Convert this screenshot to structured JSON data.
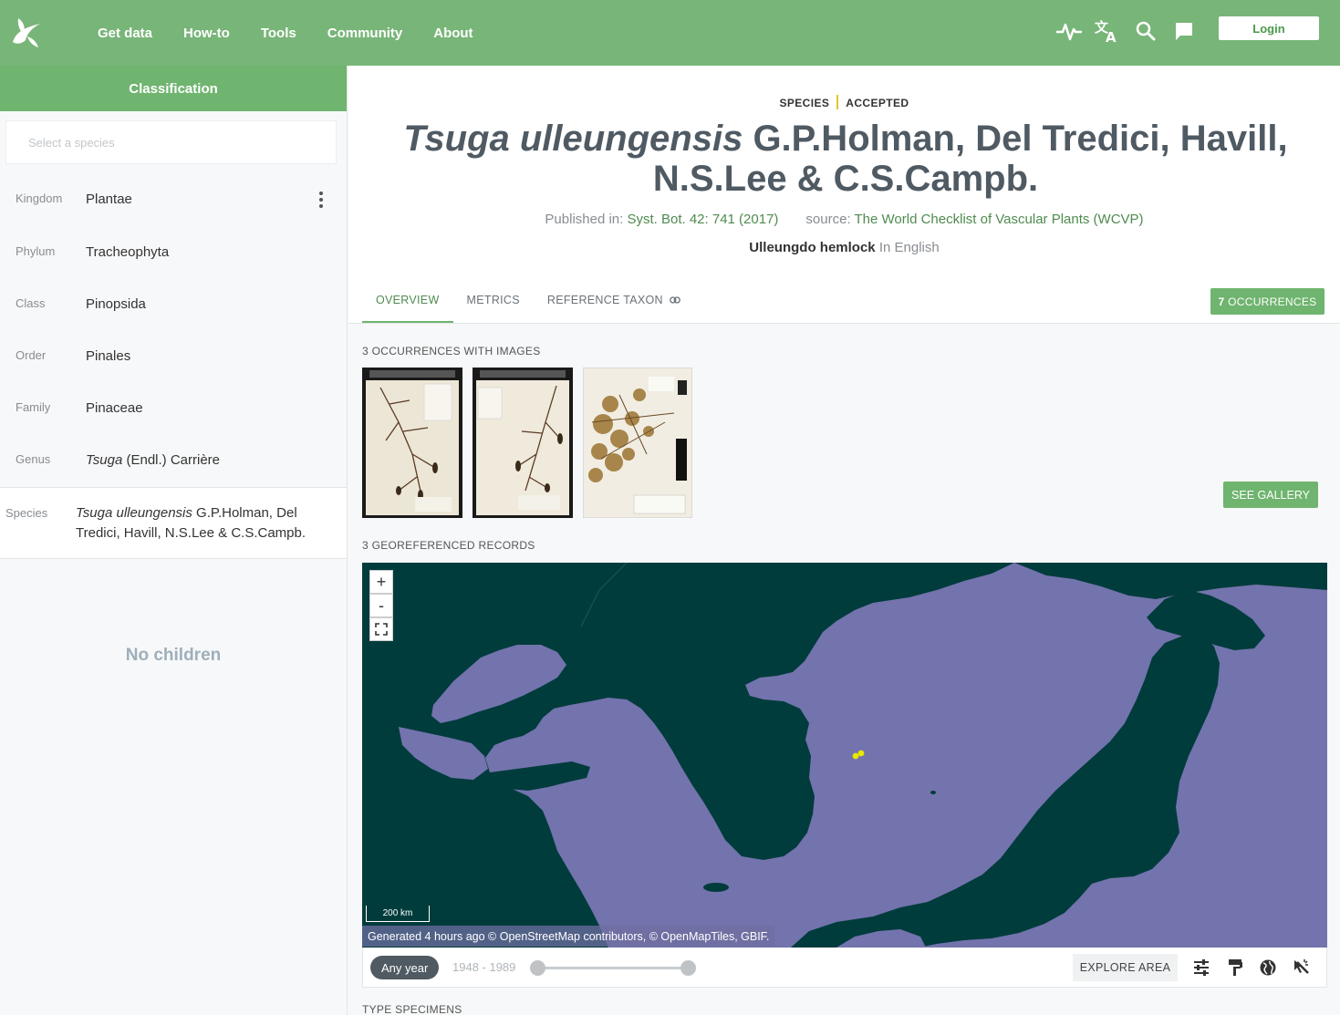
{
  "nav": {
    "items": [
      "Get data",
      "How-to",
      "Tools",
      "Community",
      "About"
    ],
    "login_label": "Login",
    "icons": [
      "pulse-icon",
      "translate-icon",
      "search-icon",
      "feedback-icon"
    ]
  },
  "sidebar": {
    "header": "Classification",
    "search_placeholder": "Select a species",
    "ranks": [
      {
        "label": "Kingdom",
        "value": "Plantae"
      },
      {
        "label": "Phylum",
        "value": "Tracheophyta"
      },
      {
        "label": "Class",
        "value": "Pinopsida"
      },
      {
        "label": "Order",
        "value": "Pinales"
      },
      {
        "label": "Family",
        "value": "Pinaceae"
      }
    ],
    "genus": {
      "label": "Genus",
      "genus_name": "Tsuga",
      "author": " (Endl.) Carrière"
    },
    "species": {
      "label": "Species",
      "name_italic": "Tsuga ulleungensis",
      "author": " G.P.Holman, Del Tredici, Havill, N.S.Lee & C.S.Campb."
    },
    "no_children": "No children"
  },
  "main": {
    "rank": "SPECIES",
    "status": "ACCEPTED",
    "title_italic": "Tsuga ulleungensis",
    "title_author": " G.P.Holman, Del Tredici, Havill, N.S.Lee & C.S.Campb.",
    "published_label": "Published in: ",
    "published_value": "Syst. Bot. 42: 741 (2017)",
    "source_label": "source: ",
    "source_value": "The World Checklist of Vascular Plants (WCVP)",
    "vernacular_name": "Ulleungdo hemlock",
    "vernacular_lang": " In English",
    "tabs": [
      "OVERVIEW",
      "METRICS",
      "REFERENCE TAXON"
    ],
    "occ_count": "7",
    "occ_label": " OCCURRENCES",
    "images_label": "3 OCCURRENCES WITH IMAGES",
    "see_gallery": "SEE GALLERY",
    "georef_label": "3 GEOREFERENCED RECORDS",
    "map": {
      "zoom_in": "+",
      "zoom_out": "-",
      "scale": "200 km",
      "attribution": "Generated 4 hours ago © OpenStreetMap contributors, © OpenMapTiles, GBIF.",
      "land_color": "#003c3c",
      "sea_color": "#7373ad",
      "point_color": "#e8e800"
    },
    "any_year": "Any year",
    "year_range": "1948 - 1989",
    "explore_area": "EXPLORE AREA",
    "type_specimens": "TYPE SPECIMENS"
  },
  "colors": {
    "brand": "#78b578",
    "accent": "#6fb46f",
    "link": "#4f8a4f"
  }
}
